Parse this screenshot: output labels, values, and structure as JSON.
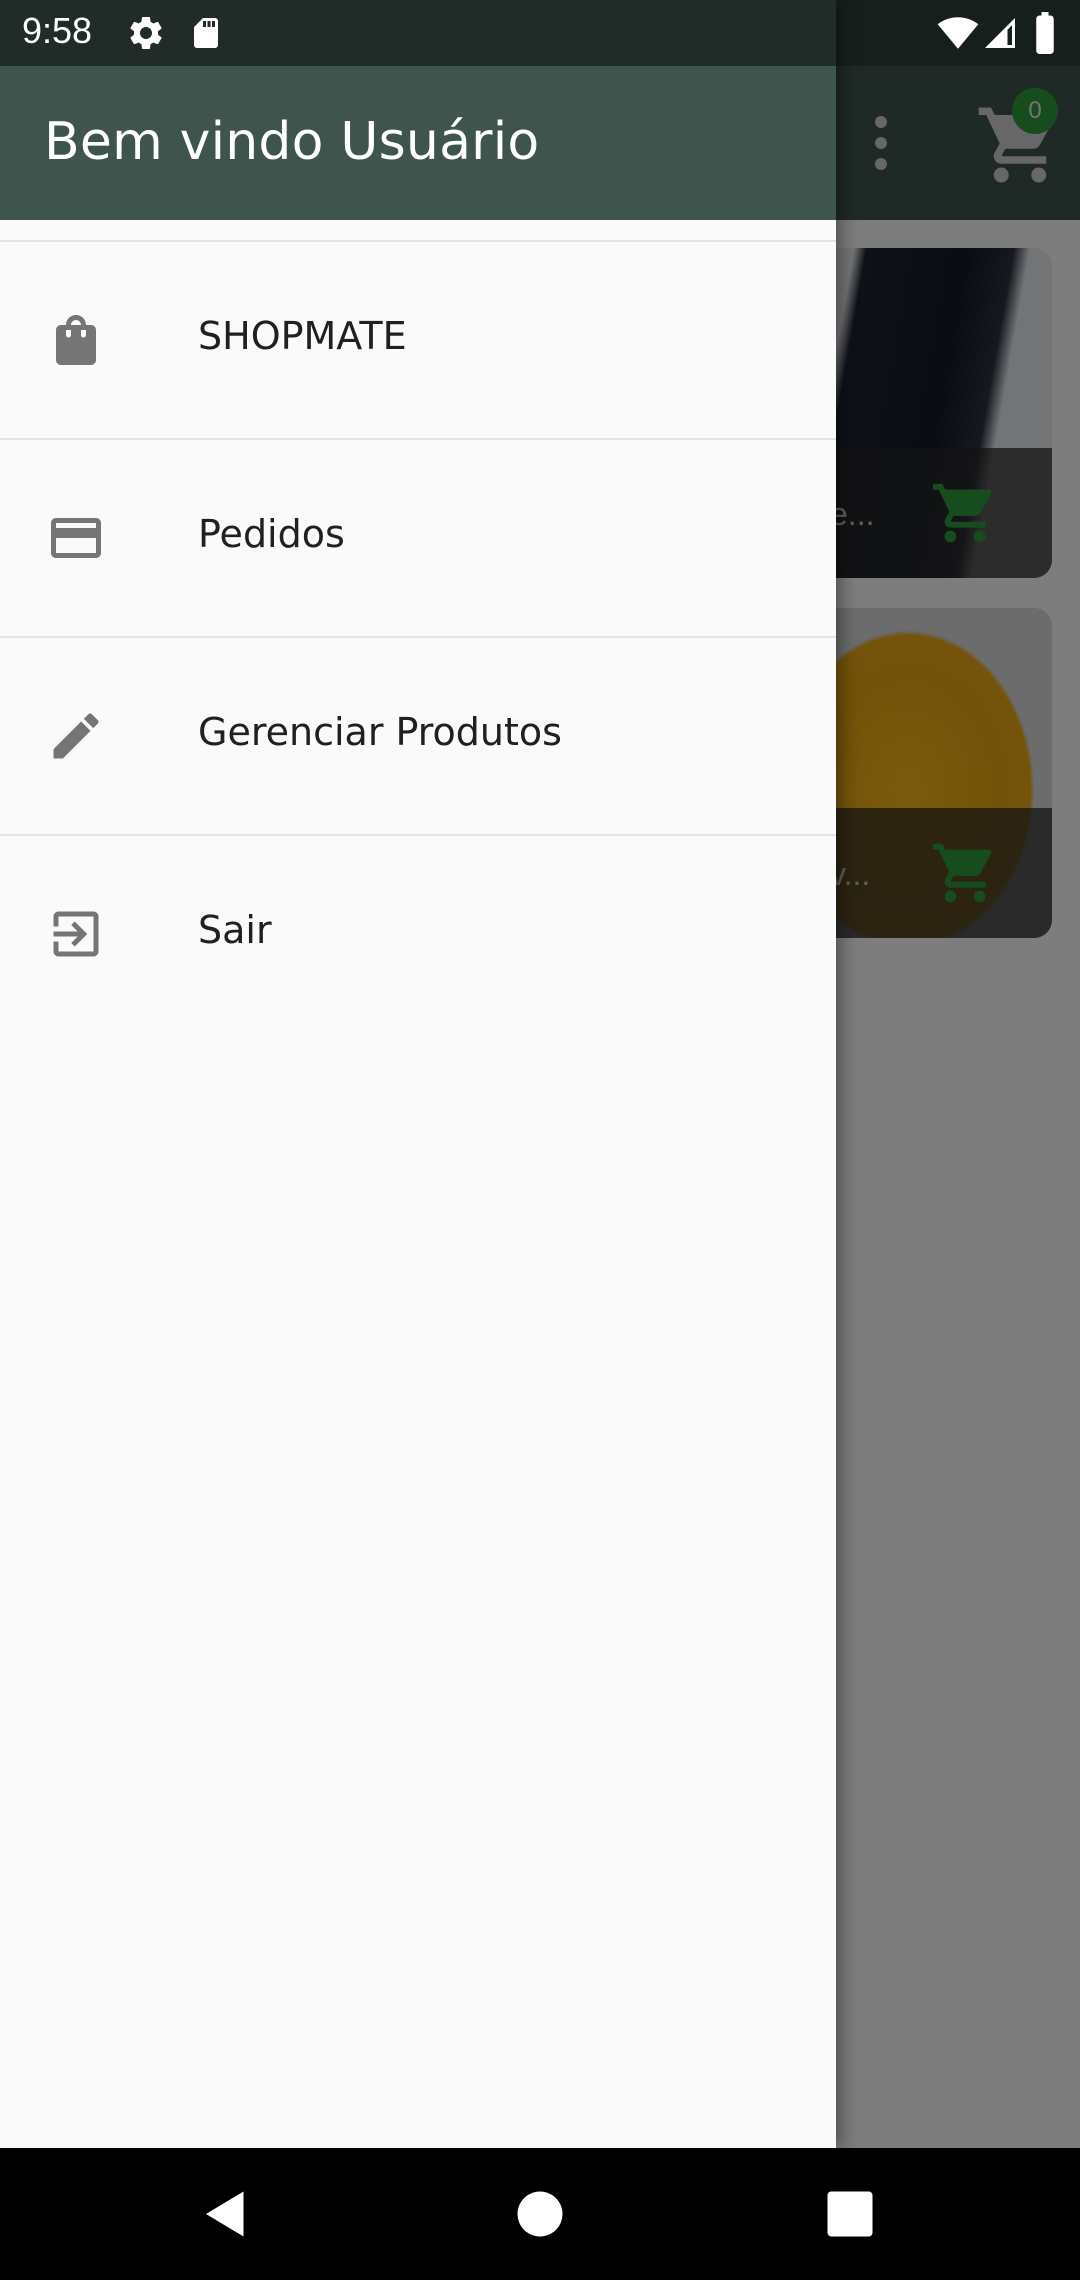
{
  "status_bar": {
    "time": "9:58",
    "icons": [
      "gear-icon",
      "sd-card-icon",
      "wifi-icon",
      "signal-icon",
      "battery-icon"
    ]
  },
  "app": {
    "cart_count": "0",
    "products": [
      {
        "name": "e..."
      },
      {
        "name": "v..."
      }
    ]
  },
  "drawer": {
    "title": "Bem vindo Usuário",
    "items": [
      {
        "label": "SHOPMATE",
        "icon": "shopping-bag-icon"
      },
      {
        "label": "Pedidos",
        "icon": "credit-card-icon"
      },
      {
        "label": "Gerenciar Produtos",
        "icon": "pencil-icon"
      },
      {
        "label": "Sair",
        "icon": "exit-icon"
      }
    ]
  },
  "colors": {
    "toolbar": "#3f544c",
    "accent_green": "#2e9b3c",
    "icon_gray": "#757575"
  },
  "nav_bar": {
    "buttons": [
      "back-icon",
      "home-icon",
      "recents-icon"
    ]
  }
}
